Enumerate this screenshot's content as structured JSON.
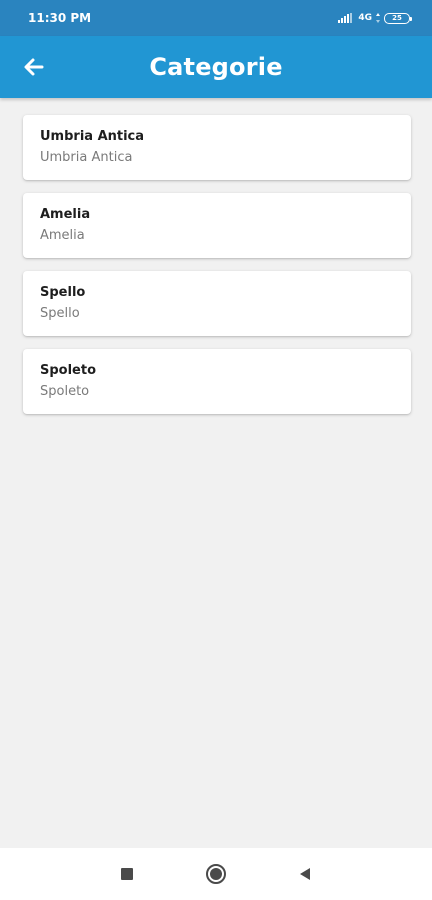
{
  "status_bar": {
    "time": "11:30 PM",
    "network": "4G",
    "battery": "25"
  },
  "app_bar": {
    "title": "Categorie",
    "back_icon": "arrow-left-icon"
  },
  "categories": [
    {
      "title": "Umbria Antica",
      "subtitle": "Umbria Antica"
    },
    {
      "title": "Amelia",
      "subtitle": "Amelia"
    },
    {
      "title": "Spello",
      "subtitle": "Spello"
    },
    {
      "title": "Spoleto",
      "subtitle": "Spoleto"
    }
  ],
  "nav_bar": {
    "recents_icon": "square-icon",
    "home_icon": "circle-icon",
    "back_icon": "triangle-back-icon"
  },
  "colors": {
    "status_bar": "#2a84bf",
    "app_bar": "#2196d3",
    "background": "#f1f1f1"
  }
}
